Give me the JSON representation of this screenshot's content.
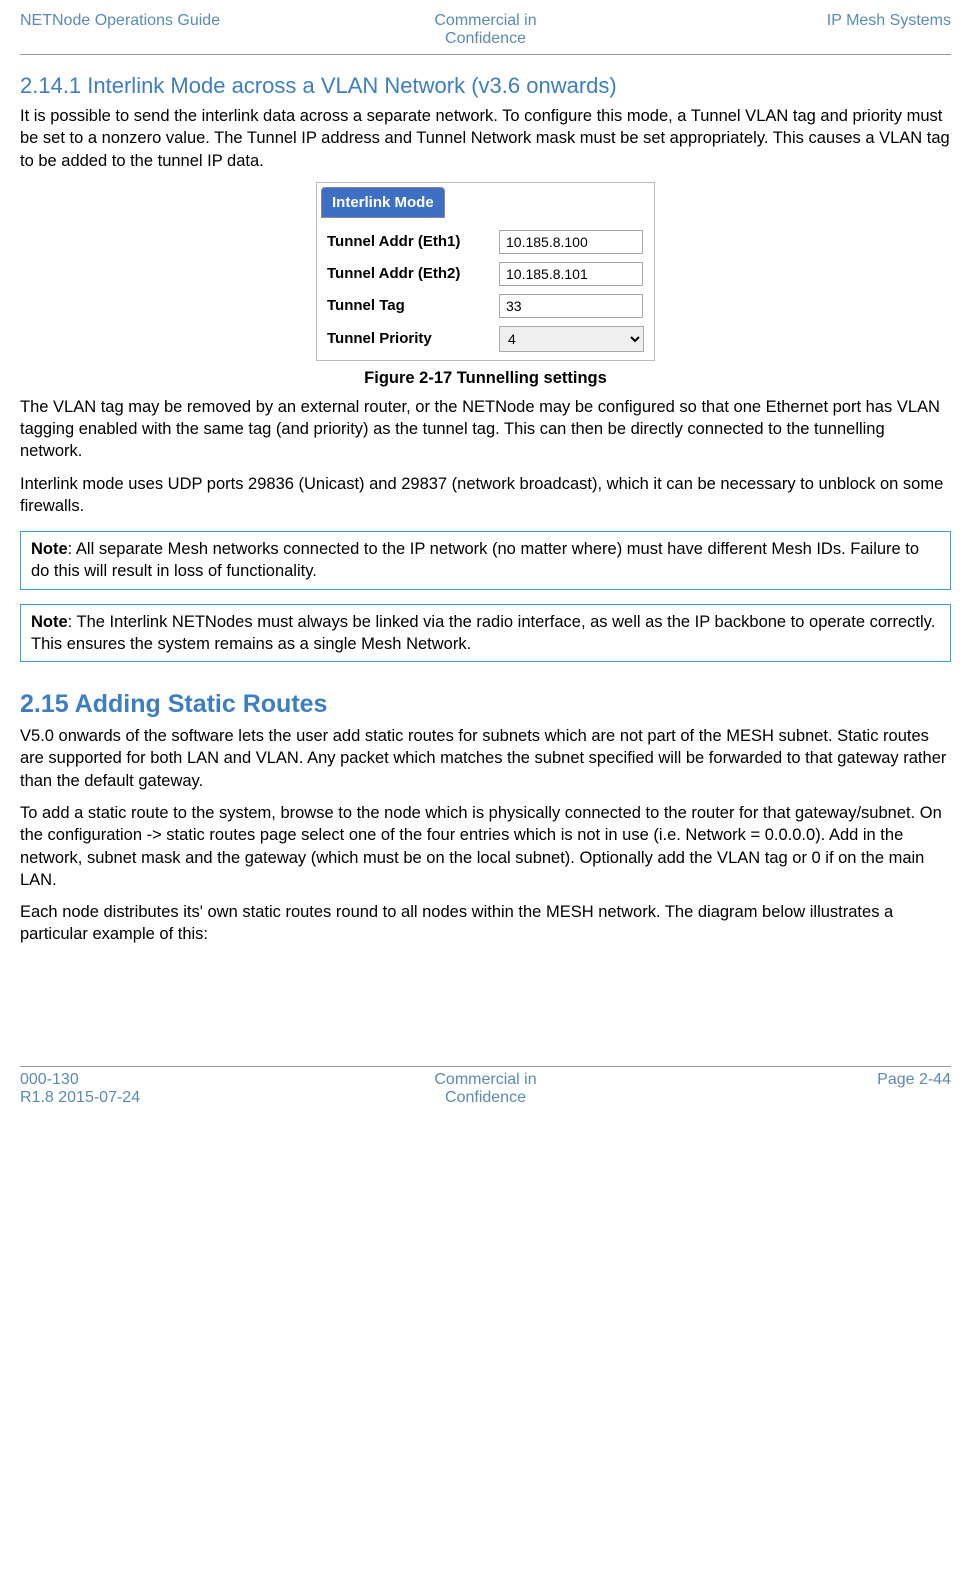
{
  "header": {
    "left": "NETNode Operations Guide",
    "mid_l1": "Commercial in",
    "mid_l2": "Confidence",
    "right": "IP Mesh Systems"
  },
  "sec1": {
    "title": "2.14.1 Interlink Mode across a VLAN Network (v3.6 onwards)",
    "p1": "It is possible to send the interlink data across a separate network. To configure this mode, a Tunnel VLAN tag and priority must be set to a nonzero value. The Tunnel IP address and Tunnel Network mask must be set appropriately. This causes a VLAN tag to be added to the tunnel IP data."
  },
  "figure": {
    "panel_title": "Interlink Mode",
    "row1_label": "Tunnel Addr (Eth1)",
    "row1_val": "10.185.8.100",
    "row2_label": "Tunnel Addr (Eth2)",
    "row2_val": "10.185.8.101",
    "row3_label": "Tunnel Tag",
    "row3_val": "33",
    "row4_label": "Tunnel Priority",
    "row4_val": "4",
    "caption": "Figure 2-17 Tunnelling settings"
  },
  "sec1b": {
    "p2": "The VLAN tag may be removed by an external router, or the NETNode may be configured so that one Ethernet port has VLAN tagging enabled with the same tag (and priority) as the tunnel tag. This can then be directly connected to the tunnelling network.",
    "p3": "Interlink mode uses UDP ports 29836 (Unicast) and 29837 (network broadcast), which it can be necessary to unblock on some firewalls."
  },
  "note1": {
    "label": "Note",
    "text": ": All separate Mesh networks connected to the IP network (no matter where) must have different Mesh IDs. Failure to do this will result in loss of functionality."
  },
  "note2": {
    "label": "Note",
    "text": ": The Interlink NETNodes must always be linked via the radio interface, as well as the IP backbone to operate correctly. This ensures the system remains as a single Mesh Network."
  },
  "sec2": {
    "heading": "2.15 Adding Static Routes",
    "p1": "V5.0 onwards of the software lets the user add static routes for subnets which are not part of the MESH subnet. Static routes are supported for both LAN and VLAN. Any packet which matches the subnet specified will be forwarded to that gateway rather than the default gateway.",
    "p2": "To add a static route to the system, browse to the node which is physically connected to the router for that gateway/subnet. On the configuration -> static routes page select one of the four entries which is not in use (i.e. Network = 0.0.0.0). Add in the network, subnet mask and the gateway (which must be on the local subnet). Optionally add the VLAN tag or 0 if on the main LAN.",
    "p3": "Each node distributes its' own static routes round to all nodes within the MESH network. The diagram below illustrates a particular example of this:"
  },
  "footer": {
    "left_l1": "000-130",
    "left_l2": "R1.8 2015-07-24",
    "mid_l1": "Commercial in",
    "mid_l2": "Confidence",
    "right": "Page 2-44"
  }
}
